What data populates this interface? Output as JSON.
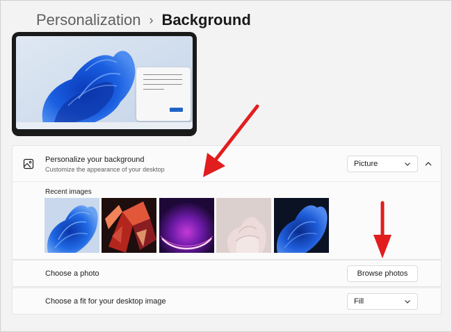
{
  "breadcrumb": {
    "parent": "Personalization",
    "separator": "›",
    "current": "Background"
  },
  "personalize": {
    "title": "Personalize your background",
    "subtitle": "Customize the appearance of your desktop",
    "select_value": "Picture",
    "icon": "image-icon",
    "collapse_icon": "chevron-up-icon"
  },
  "recent": {
    "label": "Recent images",
    "images": [
      "blue-bloom-light",
      "red-abstract-ribbons",
      "purple-glow",
      "pink-bloom",
      "blue-bloom-dark"
    ]
  },
  "choose_photo": {
    "label": "Choose a photo",
    "button": "Browse photos"
  },
  "fit": {
    "label": "Choose a fit for your desktop image",
    "select_value": "Fill"
  },
  "colors": {
    "accent": "#1f63c6",
    "annotation_arrow": "#e21d1d",
    "background": "#f3f3f3",
    "card": "#fbfbfb"
  }
}
